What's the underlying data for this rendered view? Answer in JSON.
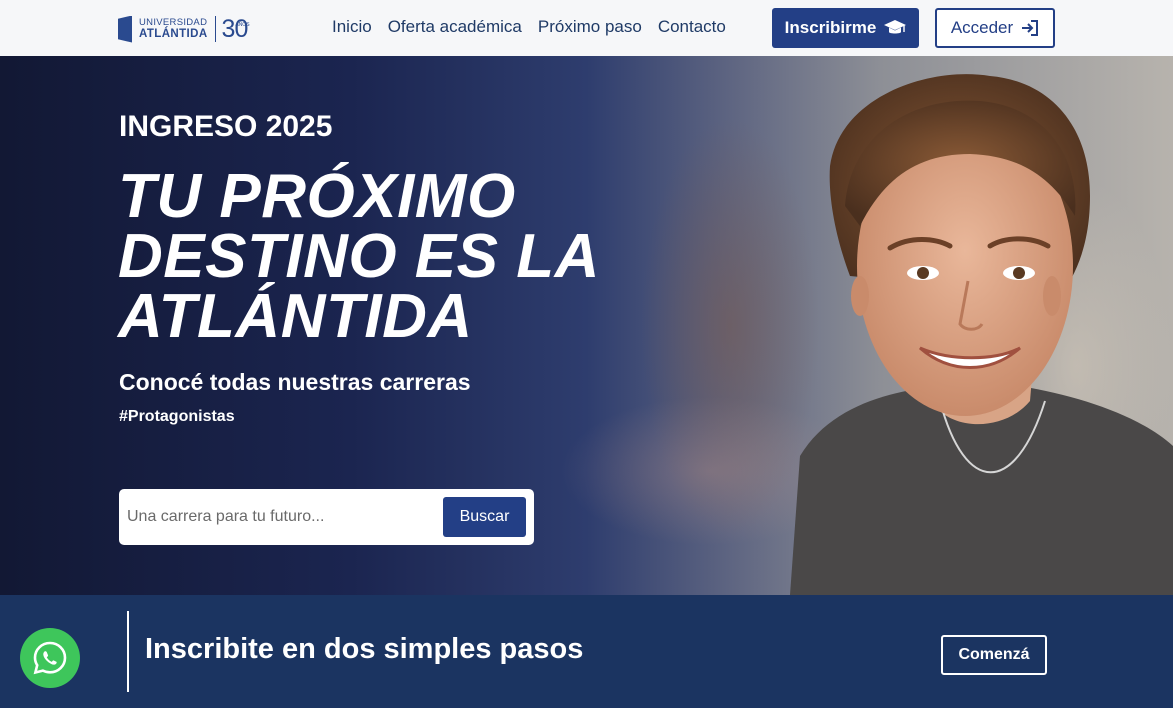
{
  "navbar": {
    "logo": {
      "line1": "UNIVERSIDAD",
      "line2": "ATLÁNTIDA",
      "anniversary": "30",
      "anniversary_suffix": "AÑOS"
    },
    "links": [
      "Inicio",
      "Oferta académica",
      "Próximo paso",
      "Contacto"
    ],
    "inscribirme_label": "Inscribirme",
    "acceder_label": "Acceder"
  },
  "hero": {
    "eyebrow": "INGRESO 2025",
    "title_lines": [
      "TU PRÓXIMO",
      "DESTINO ES LA",
      "ATLÁNTIDA"
    ],
    "subtitle": "Conocé todas nuestras carreras",
    "hashtag": "#Protagonistas",
    "search": {
      "placeholder": "Una carrera para tu futuro...",
      "button_label": "Buscar"
    }
  },
  "bottom_bar": {
    "title": "Inscribite en dos simples pasos",
    "cta_label": "Comenzá"
  },
  "colors": {
    "primary": "#233f86",
    "dark_band": "#1b3461",
    "whatsapp": "#3ec65b"
  }
}
